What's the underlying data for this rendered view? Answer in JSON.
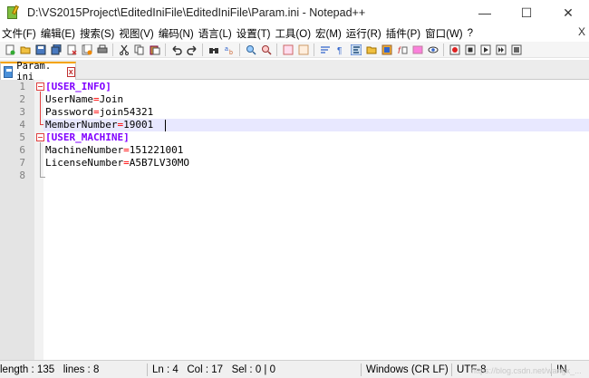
{
  "window": {
    "title": "D:\\VS2015Project\\EditedIniFile\\EditedIniFile\\Param.ini - Notepad++",
    "minimize": "—",
    "maximize": "☐",
    "close": "✕"
  },
  "menu": {
    "items": [
      "文件(F)",
      "编辑(E)",
      "搜索(S)",
      "视图(V)",
      "编码(N)",
      "语言(L)",
      "设置(T)",
      "工具(O)",
      "宏(M)",
      "运行(R)",
      "插件(P)",
      "窗口(W)",
      "?"
    ],
    "close": "X"
  },
  "tab": {
    "label": "Param. ini",
    "close": "x"
  },
  "editor": {
    "line_numbers": [
      "1",
      "2",
      "3",
      "4",
      "5",
      "6",
      "7",
      "8"
    ],
    "lines": [
      {
        "section": "[USER_INFO]"
      },
      {
        "key": "UserName",
        "eq": "=",
        "value": "Join"
      },
      {
        "key": "Password",
        "eq": "=",
        "value": "join54321"
      },
      {
        "key": "MemberNumber",
        "eq": "=",
        "value": "19001"
      },
      {
        "section": "[USER_MACHINE]"
      },
      {
        "key": "MachineNumber",
        "eq": "=",
        "value": "151221001"
      },
      {
        "key": "LicenseNumber",
        "eq": "=",
        "value": "A5B7LV30MO"
      },
      {
        "key": "",
        "eq": "",
        "value": ""
      }
    ],
    "current_line": 4
  },
  "status": {
    "length": "length : 135",
    "lines": "lines : 8",
    "ln": "Ln : 4",
    "col": "Col : 17",
    "sel": "Sel : 0 | 0",
    "eol": "Windows (CR LF)",
    "encoding": "UTF-8",
    "mode": "IN"
  },
  "watermark": "https://blog.csdn.net/wangx_..."
}
